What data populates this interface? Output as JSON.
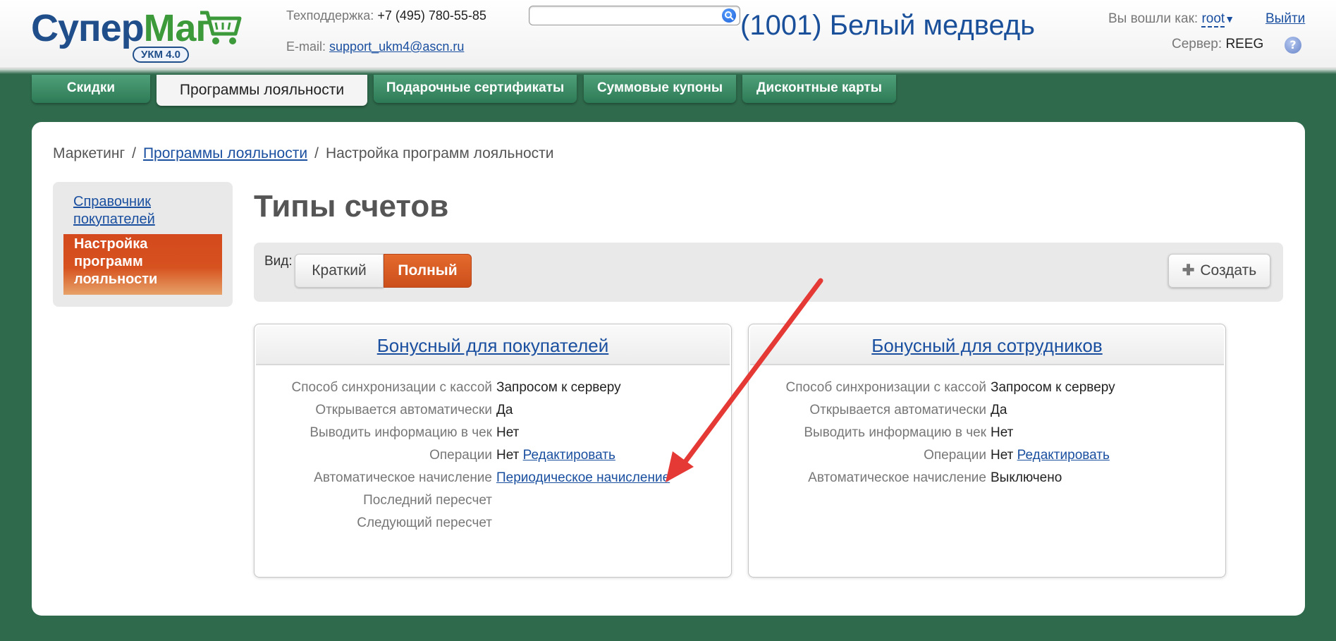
{
  "header": {
    "logo_text_a": "Супер",
    "logo_text_b": "Маг",
    "logo_badge": "УКМ 4.0",
    "support_label": "Техподдержка:",
    "support_phone": "+7 (495) 780-55-85",
    "email_label": "E-mail:",
    "email": "support_ukm4@ascn.ru",
    "search_placeholder": "",
    "store_title": "(1001) Белый медведь",
    "login_label": "Вы вошли как:",
    "user": "root",
    "logout": "Выйти",
    "server_label": "Сервер:",
    "server": "REEG",
    "help": "?"
  },
  "tabs": [
    {
      "label": "Скидки"
    },
    {
      "label": "Программы лояльности"
    },
    {
      "label": "Подарочные сертификаты"
    },
    {
      "label": "Суммовые купоны"
    },
    {
      "label": "Дисконтные карты"
    }
  ],
  "breadcrumbs": {
    "root": "Маркетинг",
    "link": "Программы лояльности",
    "current": "Настройка программ лояльности",
    "sep": "/"
  },
  "sidebar": {
    "items": [
      {
        "label": "Справочник покупателей"
      },
      {
        "label": "Настройка программ лояльности"
      }
    ]
  },
  "main": {
    "title": "Типы счетов",
    "view_label": "Вид:",
    "view_short": "Краткий",
    "view_full": "Полный",
    "create": "Создать"
  },
  "cards": [
    {
      "title": "Бонусный для покупателей",
      "rows": [
        {
          "label": "Способ синхронизации с кассой",
          "value": "Запросом к серверу"
        },
        {
          "label": "Открывается автоматически",
          "value": "Да"
        },
        {
          "label": "Выводить информацию в чек",
          "value": "Нет"
        },
        {
          "label": "Операции",
          "value": "Нет",
          "link": "Редактировать"
        },
        {
          "label": "Автоматическое начисление",
          "link": "Периодическое начисление"
        },
        {
          "label": "Последний пересчет"
        },
        {
          "label": "Следующий пересчет"
        }
      ]
    },
    {
      "title": "Бонусный для сотрудников",
      "rows": [
        {
          "label": "Способ синхронизации с кассой",
          "value": "Запросом к серверу"
        },
        {
          "label": "Открывается автоматически",
          "value": "Да"
        },
        {
          "label": "Выводить информацию в чек",
          "value": "Нет"
        },
        {
          "label": "Операции",
          "value": "Нет",
          "link": "Редактировать"
        },
        {
          "label": "Автоматическое начисление",
          "value": "Выключено"
        }
      ]
    }
  ],
  "colors": {
    "background": "#2f6a4c",
    "link": "#1a4fa0",
    "accent": "#d6521f",
    "arrow": "#e53935"
  }
}
